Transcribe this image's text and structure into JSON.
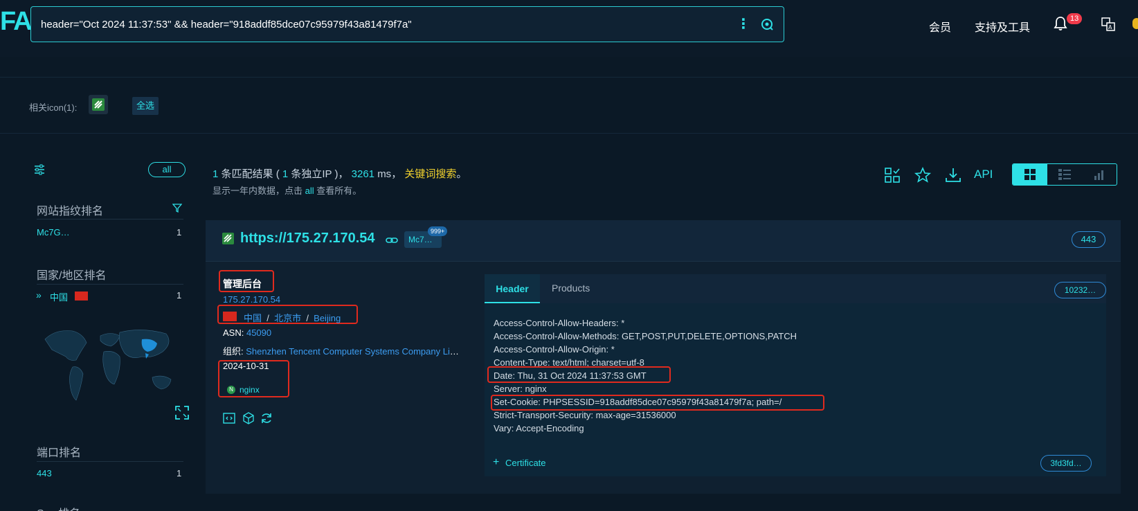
{
  "header": {
    "logo": "FA",
    "search_query": "header=\"Oct 2024 11:37:53\" && header=\"918addf85dce07c95979f43a81479f7a\"",
    "nav": {
      "member": "会员",
      "tools": "支持及工具"
    },
    "notifications": "13"
  },
  "icon_filter": {
    "label": "相关icon(1):",
    "select_all": "全选"
  },
  "sidebar": {
    "all_label": "all",
    "fingerprint": {
      "title": "网站指纹排名",
      "items": [
        {
          "name": "Mc7G…",
          "count": "1"
        }
      ]
    },
    "country": {
      "title": "国家/地区排名",
      "items": [
        {
          "name": "中国",
          "count": "1"
        }
      ]
    },
    "port": {
      "title": "端口排名",
      "items": [
        {
          "name": "443",
          "count": "1"
        }
      ]
    },
    "server_partial": "S… 排名"
  },
  "results": {
    "count": "1",
    "count_label": "条匹配结果",
    "ip_count": "1",
    "ip_label": "条独立IP",
    "time": "3261",
    "time_unit": "ms",
    "keyword_label": "关键词搜索",
    "sub_pre": "显示一年内数据，点击",
    "sub_link": "all",
    "sub_post": "查看所有。",
    "api_label": "API"
  },
  "card": {
    "url": "https://175.27.170.54",
    "tag": "Mc7…",
    "tag_badge": "999+",
    "port": "443",
    "title": "管理后台",
    "ip": "175.27.170.54",
    "country": "中国",
    "city": "北京市",
    "region": "Beijing",
    "asn_label": "ASN:",
    "asn": "45090",
    "org_label": "组织:",
    "org": "Shenzhen Tencent Computer Systems Company Limited",
    "date": "2024-10-31",
    "server": "nginx",
    "tabs": {
      "header": "Header",
      "products": "Products"
    },
    "hash": "10232…",
    "headers": [
      "Access-Control-Allow-Headers: *",
      "Access-Control-Allow-Methods: GET,POST,PUT,DELETE,OPTIONS,PATCH",
      "Access-Control-Allow-Origin: *",
      "Content-Type: text/html; charset=utf-8",
      "Date: Thu, 31 Oct 2024 11:37:53 GMT",
      "Server: nginx",
      "Set-Cookie: PHPSESSID=918addf85dce07c95979f43a81479f7a; path=/",
      "Strict-Transport-Security: max-age=31536000",
      "Vary: Accept-Encoding"
    ],
    "certificate_label": "Certificate",
    "cert_hash": "3fd3fd…"
  }
}
